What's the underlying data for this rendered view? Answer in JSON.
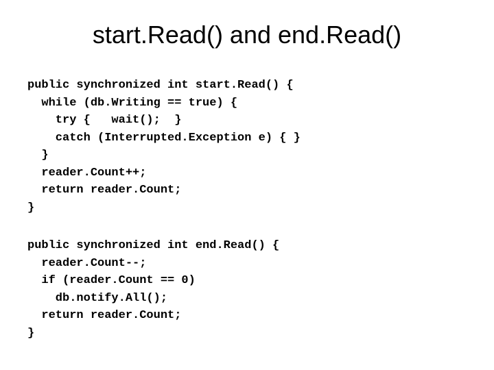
{
  "title": "start.Read() and end.Read()",
  "code1": "public synchronized int start.Read() {\n  while (db.Writing == true) {\n    try {   wait();  }\n    catch (Interrupted.Exception e) { }\n  }\n  reader.Count++;\n  return reader.Count;\n}",
  "code2": "public synchronized int end.Read() {\n  reader.Count--;\n  if (reader.Count == 0)\n    db.notify.All();\n  return reader.Count;\n}"
}
